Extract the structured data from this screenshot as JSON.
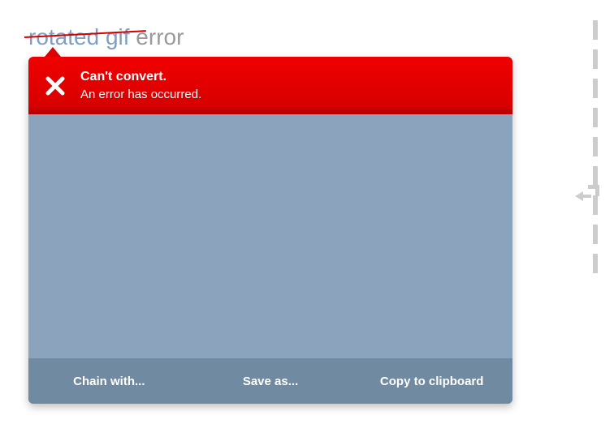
{
  "title": {
    "link_text": "rotated gif",
    "suffix_text": " error"
  },
  "error": {
    "heading": "Can't convert.",
    "message": "An error has occurred."
  },
  "footer": {
    "chain": "Chain with...",
    "save": "Save as...",
    "copy": "Copy to clipboard"
  }
}
